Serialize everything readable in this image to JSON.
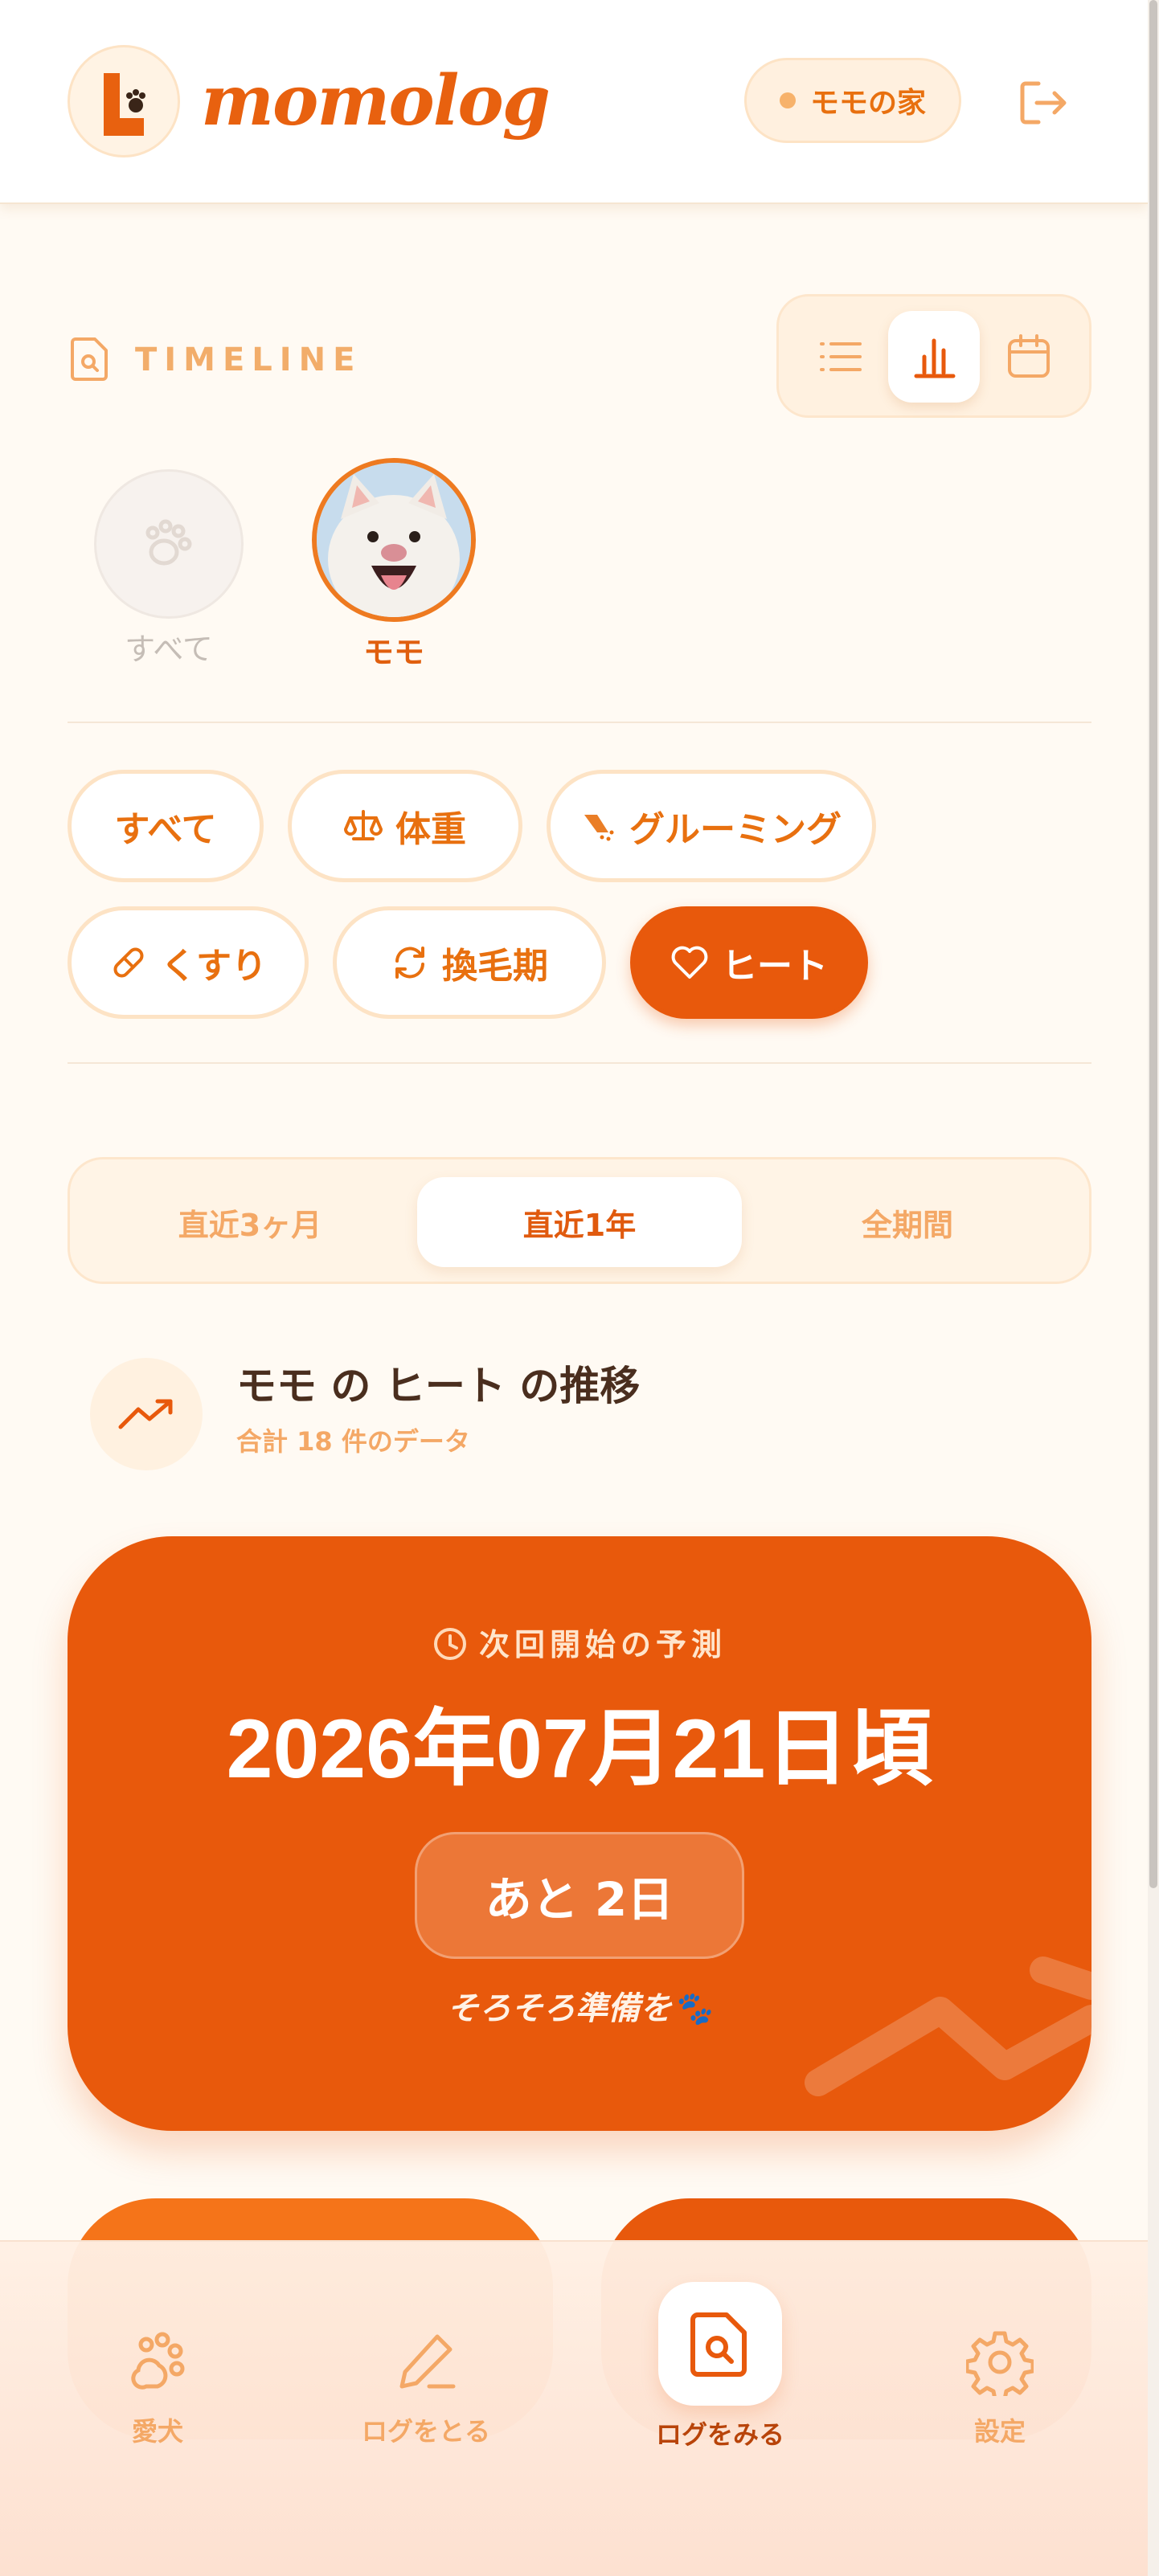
{
  "header": {
    "brand": "momolog",
    "home_label": "モモの家"
  },
  "section": {
    "title": "TIMELINE"
  },
  "pets": [
    {
      "label": "すべて",
      "selected": false
    },
    {
      "label": "モモ",
      "selected": true
    }
  ],
  "filters": [
    {
      "label": "すべて",
      "icon": "none",
      "active": false
    },
    {
      "label": "体重",
      "icon": "scale-icon",
      "active": false
    },
    {
      "label": "グルーミング",
      "icon": "shower-icon",
      "active": false
    },
    {
      "label": "くすり",
      "icon": "pill-icon",
      "active": false
    },
    {
      "label": "換毛期",
      "icon": "refresh-icon",
      "active": false
    },
    {
      "label": "ヒート",
      "icon": "heart-icon",
      "active": true
    }
  ],
  "period": {
    "options": [
      "直近3ヶ月",
      "直近1年",
      "全期間"
    ],
    "selected": "直近1年"
  },
  "trend": {
    "title": "モモ の ヒート の推移",
    "subtitle": "合計 18 件のデータ"
  },
  "prediction": {
    "label": "次回開始の予測",
    "date": "2026年07月21日頃",
    "remaining": "あと 2日",
    "note": "そろそろ準備を🐾"
  },
  "nav": [
    {
      "label": "愛犬",
      "icon": "paw-icon",
      "active": false
    },
    {
      "label": "ログをとる",
      "icon": "pencil-icon",
      "active": false
    },
    {
      "label": "ログをみる",
      "icon": "document-search-icon",
      "active": true
    },
    {
      "label": "設定",
      "icon": "gear-icon",
      "active": false
    }
  ],
  "colors": {
    "accent": "#e8590c",
    "accent_light": "#f4a866",
    "background": "#fffaf3"
  }
}
